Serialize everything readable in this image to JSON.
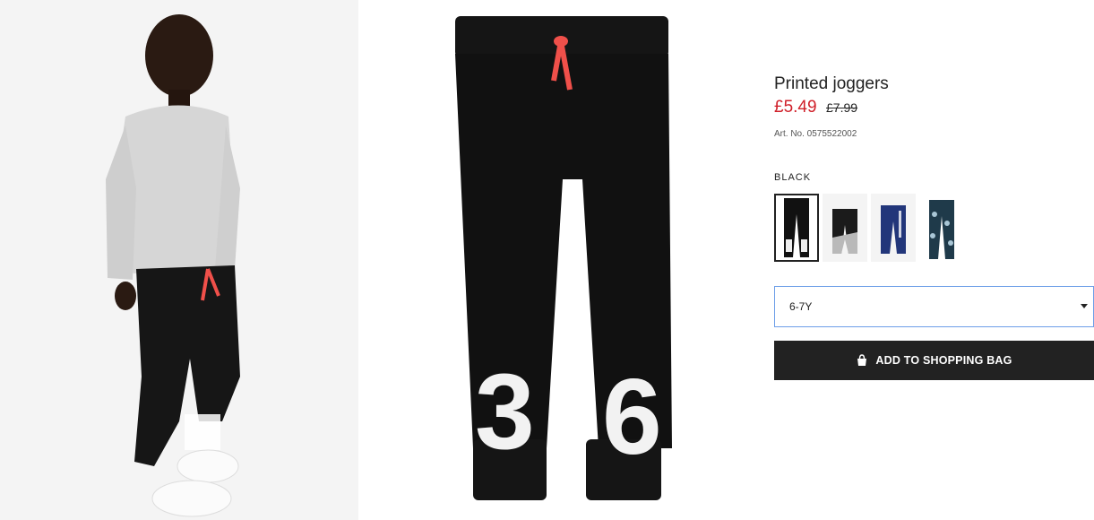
{
  "product": {
    "title": "Printed joggers",
    "price_sale": "£5.49",
    "price_old": "£7.99",
    "article_number": "Art. No. 0575522002"
  },
  "color": {
    "selected_name": "BLACK",
    "swatches": [
      {
        "name": "black",
        "selected": true
      },
      {
        "name": "black-grey",
        "selected": false
      },
      {
        "name": "navy",
        "selected": false
      },
      {
        "name": "dark-blue-print",
        "selected": false
      }
    ]
  },
  "size": {
    "selected": "6-7Y"
  },
  "actions": {
    "add_to_bag": "ADD TO SHOPPING BAG"
  },
  "colors": {
    "sale_price": "#d0202a",
    "button_bg": "#222222",
    "select_border": "#6d9ee8",
    "drawstring": "#f0504a"
  },
  "icons": {
    "bag": "shopping-bag-icon",
    "caret": "chevron-down-icon"
  }
}
